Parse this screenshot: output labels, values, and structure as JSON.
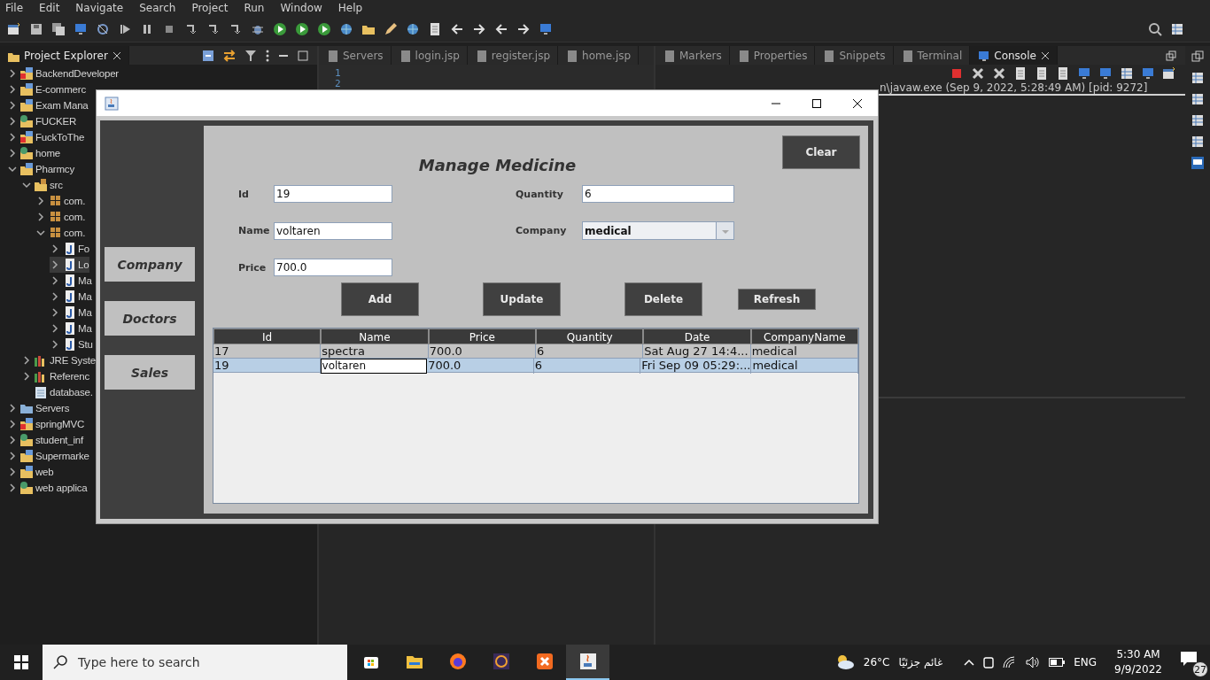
{
  "menu": [
    "File",
    "Edit",
    "Navigate",
    "Search",
    "Project",
    "Run",
    "Window",
    "Help"
  ],
  "project_explorer": {
    "title": "Project Explorer",
    "items": [
      {
        "label": "BackendDeveloper",
        "kind": "error-project",
        "expanded": false,
        "selected": false
      },
      {
        "label": "E-commerc",
        "kind": "project",
        "expanded": false,
        "selected": false
      },
      {
        "label": "Exam Mana",
        "kind": "project",
        "expanded": false,
        "selected": false
      },
      {
        "label": "FUCKER",
        "kind": "web-project",
        "expanded": false,
        "selected": false
      },
      {
        "label": "FuckToThe",
        "kind": "error-project",
        "expanded": false,
        "selected": false
      },
      {
        "label": "home",
        "kind": "web-project",
        "expanded": false,
        "selected": false
      },
      {
        "label": "Pharmcy",
        "kind": "project",
        "expanded": true,
        "selected": false,
        "children": [
          {
            "label": "src",
            "kind": "source-folder",
            "expanded": true,
            "selected": false,
            "children": [
              {
                "label": "com.",
                "kind": "package",
                "expanded": false,
                "selected": false
              },
              {
                "label": "com.",
                "kind": "package",
                "expanded": false,
                "selected": false
              },
              {
                "label": "com.",
                "kind": "package",
                "expanded": true,
                "selected": false,
                "children": [
                  {
                    "label": "Fo",
                    "kind": "java-file",
                    "expanded": false,
                    "selected": false
                  },
                  {
                    "label": "Lo",
                    "kind": "java-file",
                    "expanded": false,
                    "selected": true
                  },
                  {
                    "label": "Ma",
                    "kind": "java-file",
                    "expanded": false,
                    "selected": false
                  },
                  {
                    "label": "Ma",
                    "kind": "java-file",
                    "expanded": false,
                    "selected": false
                  },
                  {
                    "label": "Ma",
                    "kind": "java-file",
                    "expanded": false,
                    "selected": false
                  },
                  {
                    "label": "Ma",
                    "kind": "java-file",
                    "expanded": false,
                    "selected": false
                  },
                  {
                    "label": "Stu",
                    "kind": "java-file",
                    "expanded": false,
                    "selected": false
                  }
                ]
              }
            ]
          },
          {
            "label": "JRE Syste",
            "kind": "library",
            "expanded": false,
            "selected": false
          },
          {
            "label": "Referenc",
            "kind": "library",
            "expanded": false,
            "selected": false
          },
          {
            "label": "database.",
            "kind": "file",
            "selected": false
          }
        ]
      },
      {
        "label": "Servers",
        "kind": "folder",
        "expanded": false,
        "selected": false
      },
      {
        "label": "springMVC",
        "kind": "error-project",
        "expanded": false,
        "selected": false
      },
      {
        "label": "student_inf",
        "kind": "web-project",
        "expanded": false,
        "selected": false
      },
      {
        "label": "Supermarke",
        "kind": "project",
        "expanded": false,
        "selected": false
      },
      {
        "label": "web",
        "kind": "project",
        "expanded": false,
        "selected": false
      },
      {
        "label": "web applica",
        "kind": "web-project",
        "expanded": false,
        "selected": false
      }
    ]
  },
  "editor": {
    "tabs": [
      {
        "label": "Servers",
        "selected": false
      },
      {
        "label": "login.jsp",
        "selected": false
      },
      {
        "label": "register.jsp",
        "selected": false
      },
      {
        "label": "home.jsp",
        "selected": false
      }
    ],
    "line_numbers": [
      "1",
      "2"
    ]
  },
  "console_panel": {
    "tabs": [
      {
        "label": "Markers",
        "selected": false
      },
      {
        "label": "Properties",
        "selected": false
      },
      {
        "label": "Snippets",
        "selected": false
      },
      {
        "label": "Terminal",
        "selected": false
      },
      {
        "label": "Console",
        "selected": true
      }
    ],
    "output": "n\\javaw.exe  (Sep 9, 2022, 5:28:49 AM) [pid: 9272]"
  },
  "dialog": {
    "nav_buttons": [
      "Company",
      "Doctors",
      "Sales"
    ],
    "heading": "Manage Medicine",
    "clear_button": "Clear",
    "fields": [
      {
        "label": "Id",
        "value": "19",
        "kind": "text"
      },
      {
        "label": "Quantity",
        "value": "6",
        "kind": "text"
      },
      {
        "label": "Name",
        "value": "voltaren",
        "kind": "text"
      },
      {
        "label": "Company",
        "value": "medical",
        "kind": "combo"
      },
      {
        "label": "Price",
        "value": "700.0",
        "kind": "text"
      }
    ],
    "actions": [
      {
        "label": "Add",
        "kind": "large"
      },
      {
        "label": "Update",
        "kind": "large"
      },
      {
        "label": "Delete",
        "kind": "large"
      },
      {
        "label": "Refresh",
        "kind": "small"
      }
    ],
    "table": {
      "columns": [
        "Id",
        "Name",
        "Price",
        "Quantity",
        "Date",
        "CompanyName"
      ],
      "rows": [
        {
          "selected": false,
          "cells": [
            {
              "text": "17",
              "focused": false
            },
            {
              "text": "spectra",
              "focused": false
            },
            {
              "text": "700.0",
              "focused": false
            },
            {
              "text": "6",
              "focused": false
            },
            {
              "text": "Sat Aug 27 14:4...",
              "focused": false
            },
            {
              "text": "medical",
              "focused": false
            }
          ]
        },
        {
          "selected": true,
          "cells": [
            {
              "text": "19",
              "focused": false
            },
            {
              "text": "voltaren",
              "focused": true
            },
            {
              "text": "700.0",
              "focused": false
            },
            {
              "text": "6",
              "focused": false
            },
            {
              "text": "Fri Sep 09 05:29:...",
              "focused": false
            },
            {
              "text": "medical",
              "focused": false
            }
          ]
        }
      ]
    }
  },
  "taskbar": {
    "search_placeholder": "Type here to search",
    "apps": [
      {
        "kind": "store",
        "active": false
      },
      {
        "kind": "folder",
        "active": false
      },
      {
        "kind": "browser",
        "active": false
      },
      {
        "kind": "ide",
        "active": false
      },
      {
        "kind": "xampp",
        "active": false
      },
      {
        "kind": "java",
        "active": true
      }
    ],
    "temperature": "26°C",
    "weather": "غائم جزئيًا",
    "language": "ENG",
    "time": "5:30 AM",
    "date": "9/9/2022",
    "notifications": "27"
  }
}
